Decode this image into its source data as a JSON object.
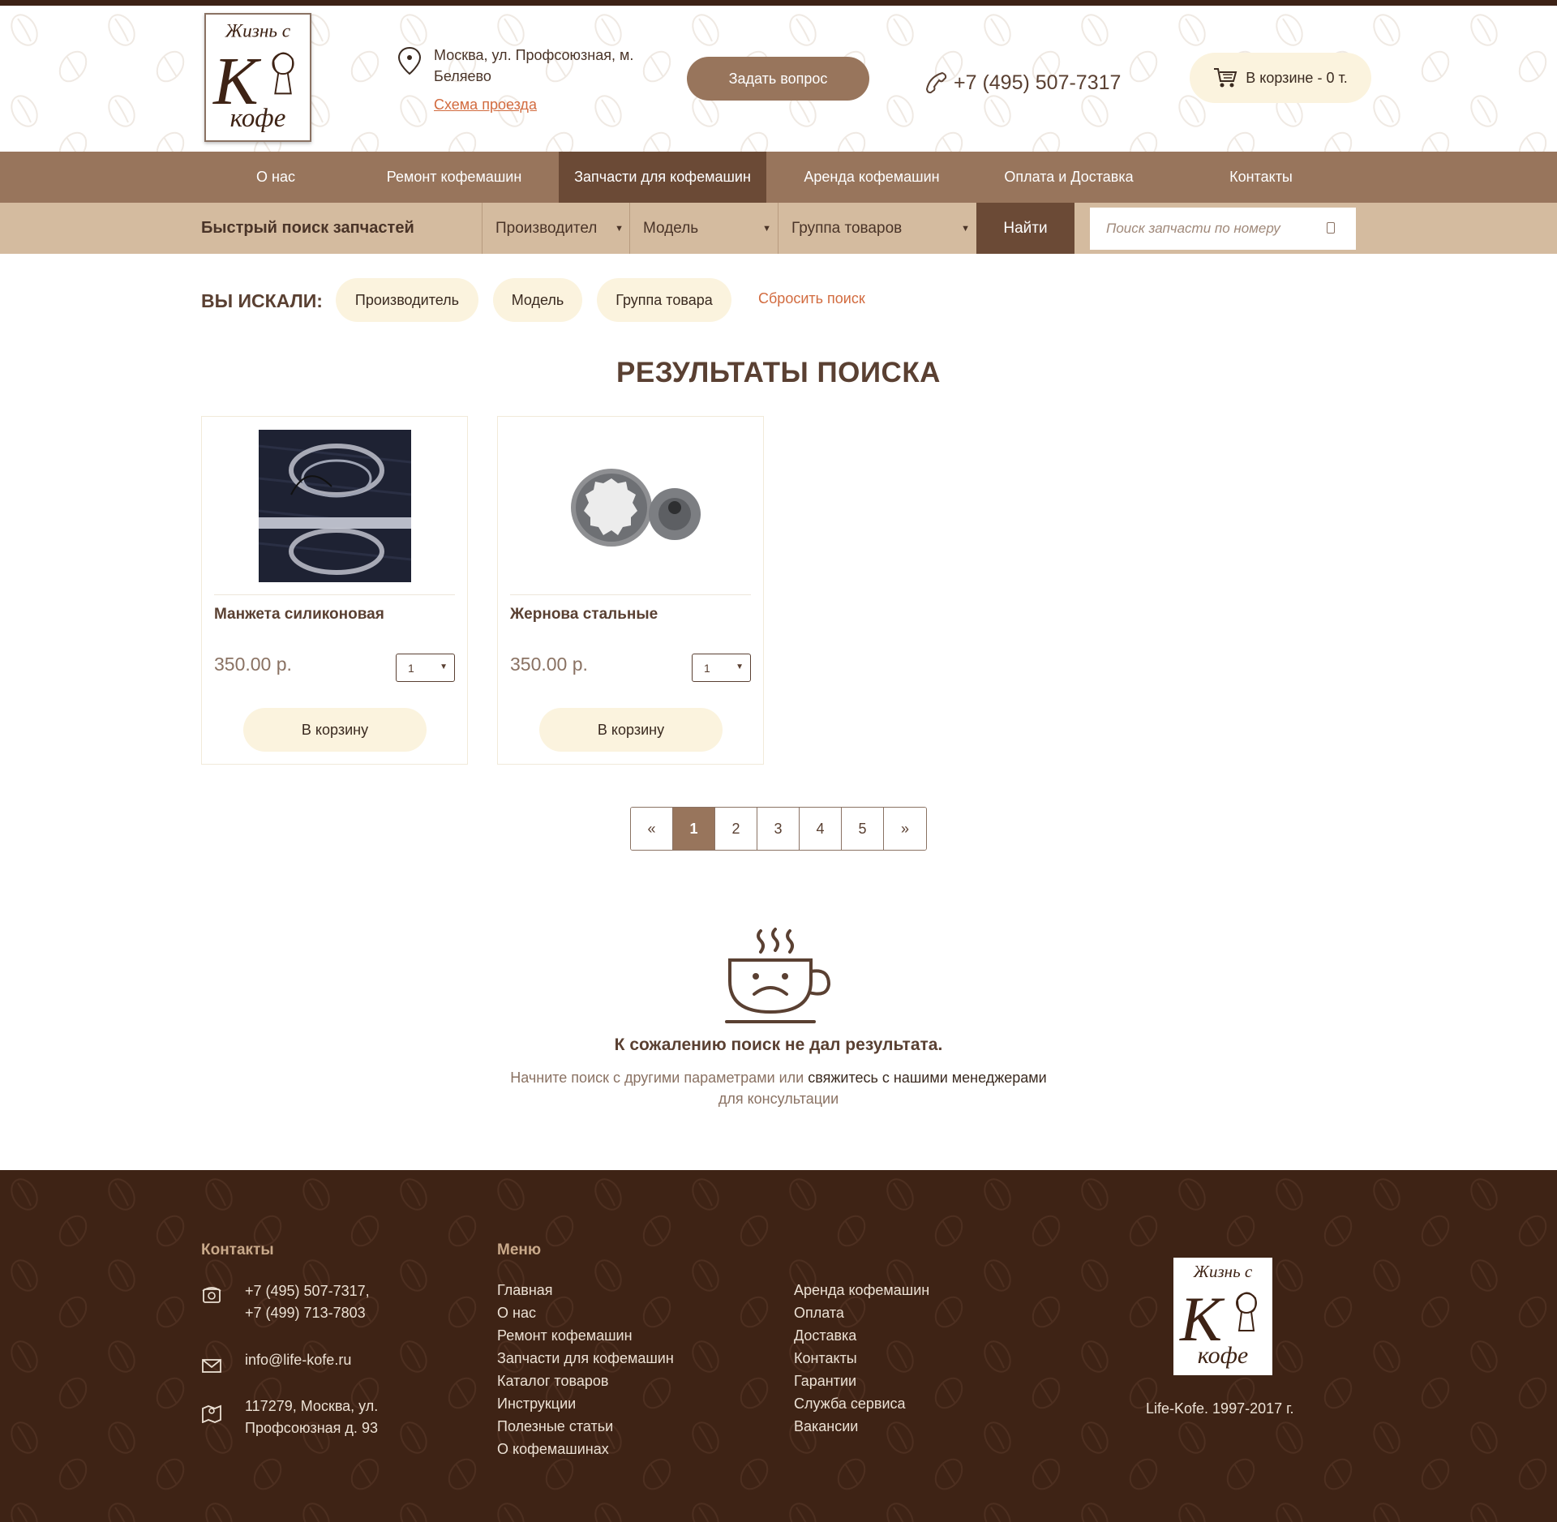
{
  "header": {
    "logo_lines": [
      "Жизнь с",
      "K",
      "кофе"
    ],
    "address": "Москва, ул. Профсоюзная, м. Беляево",
    "route_link": "Схема проезда",
    "ask_button": "Задать вопрос",
    "phone": "+7 (495) 507-7317",
    "cart": "В корзине - 0 т."
  },
  "nav": {
    "items": [
      {
        "label": "О нас"
      },
      {
        "label": "Ремонт кофемашин"
      },
      {
        "label": "Запчасти для кофемашин"
      },
      {
        "label": "Аренда кофемашин"
      },
      {
        "label": "Оплата и Доставка"
      },
      {
        "label": "Контакты"
      }
    ],
    "active": "Запчасти для кофемашин"
  },
  "filter": {
    "title": "Быстрый поиск запчастей",
    "manufacturer": "Производител",
    "model": "Модель",
    "group": "Группа товаров",
    "find_button": "Найти",
    "search_placeholder": "Поиск запчасти по номеру"
  },
  "searched": {
    "label": "ВЫ ИСКАЛИ:",
    "chips": [
      "Производитель",
      "Модель",
      "Группа товара"
    ],
    "reset": "Сбросить поиск"
  },
  "results": {
    "title": "РЕЗУЛЬТАТЫ ПОИСКА",
    "products": [
      {
        "name": "Манжета силиконовая",
        "price": "350.00 р.",
        "qty": "1",
        "button": "В корзину"
      },
      {
        "name": "Жернова стальные",
        "price": "350.00 р.",
        "qty": "1",
        "button": "В корзину"
      }
    ]
  },
  "pagination": {
    "prev": "«",
    "pages": [
      "1",
      "2",
      "3",
      "4",
      "5"
    ],
    "current": "1",
    "next": "»"
  },
  "no_result": {
    "title": "К сожалению поиск не дал результата.",
    "text_start": "Начните поиск с другими параметрами или ",
    "text_link": "свяжитесь с нашими менеджерами",
    "text_end": "для консультации"
  },
  "footer": {
    "contacts_title": "Контакты",
    "phone1": "+7 (495) 507-7317,",
    "phone2": "+7 (499) 713-7803",
    "email": "info@life-kofe.ru",
    "address1": "117279, Москва, ул.",
    "address2": "Профсоюзная д. 93",
    "menu_title": "Меню",
    "menu_col1": [
      "Главная",
      "О нас",
      "Ремонт кофемашин",
      "Запчасти для кофемашин",
      "Каталог товаров",
      "Инструкции",
      "Полезные статьи",
      "О кофемашинах"
    ],
    "menu_col2": [
      "Аренда кофемашин",
      "Оплата",
      "Доставка",
      "Контакты",
      "Гарантии",
      "Служба сервиса",
      "Вакансии"
    ],
    "copyright": "Life-Kofe. 1997-2017 г."
  },
  "colors": {
    "brown_dark": "#3e2315",
    "brown_nav": "#98755c",
    "brown_active": "#6b4a36",
    "beige_filter": "#d4bb9f",
    "cream_button": "#fbf3de",
    "accent_orange": "#d26b3f"
  },
  "icons": [
    "map-pin-icon",
    "phone-icon",
    "cart-icon",
    "search-icon",
    "sad-coffee-cup-icon",
    "footer-phone-icon",
    "footer-mail-icon",
    "footer-map-icon"
  ]
}
